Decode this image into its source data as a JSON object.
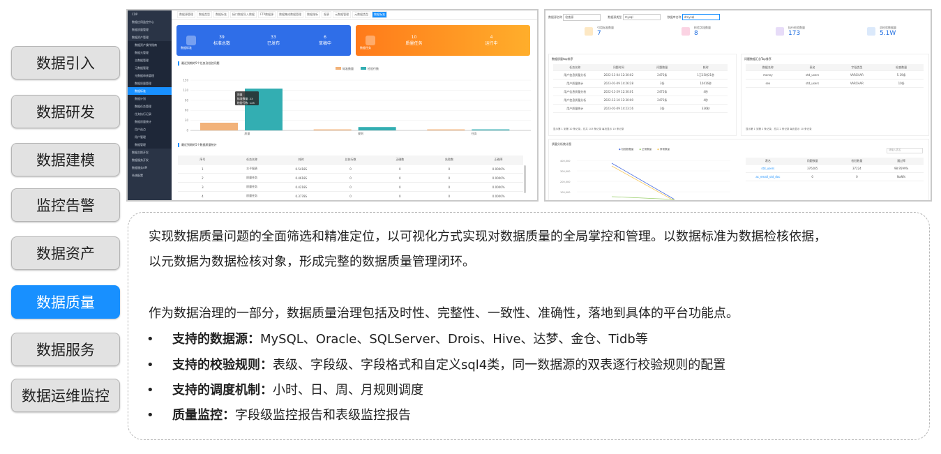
{
  "nav": {
    "items": [
      {
        "label": "数据引入",
        "active": false
      },
      {
        "label": "数据研发",
        "active": false
      },
      {
        "label": "数据建模",
        "active": false
      },
      {
        "label": "监控告警",
        "active": false
      },
      {
        "label": "数据资产",
        "active": false
      },
      {
        "label": "数据质量",
        "active": true
      },
      {
        "label": "数据服务",
        "active": false
      },
      {
        "label": "数据运维监控",
        "active": false
      }
    ]
  },
  "colors": {
    "active": "#1890ff",
    "inactive_bg": "#e2e2e2",
    "card_blue": "#2f6ee8",
    "card_orange": "#ff8a1c"
  },
  "screenshot1": {
    "sidebar": [
      "CDP",
      "数据应用监控中心",
      "数据质量管理",
      "数据资产管理",
      "数据资产操作指南",
      "数据元管理",
      "主数据管理",
      "元数据管理",
      "元数据审核管理",
      "数据质量管理",
      "数据标准",
      "数据计划",
      "数据任务管理",
      "任务执行记录",
      "数据质量统计",
      "用户选点",
      "用户管理",
      "数据管理",
      "数据交换开发",
      "数据服务开发",
      "数据服务API",
      "系统配置"
    ],
    "tabs": [
      "数据源管理",
      "数据类型",
      "数据标准",
      "接口数据导入数据",
      "FTP数据源",
      "数据集成数据管理",
      "数据指标",
      "报表",
      "元数据管理",
      "元数据类型",
      "数据标准"
    ],
    "card_blue": {
      "label": "数据标准",
      "kpis": [
        {
          "value": "39",
          "label": "标准总数"
        },
        {
          "value": "33",
          "label": "已发布"
        },
        {
          "value": "6",
          "label": "草稿中"
        }
      ]
    },
    "card_orange": {
      "label": "数据任务",
      "kpis": [
        {
          "value": "10",
          "label": "质量任务"
        },
        {
          "value": "4",
          "label": "运行中"
        }
      ]
    },
    "chart_title": "最近到期的5个任务及检验问题",
    "chart_legend": [
      "标准数量",
      "检验行数"
    ],
    "chart_tooltip": {
      "title": "质量",
      "l1": "标准数量: 23",
      "l2": "检验行数: 125"
    },
    "table_title": "最近到期的5个数据质量统计",
    "table_head": [
      "序号",
      "任务名称",
      "耗时",
      "总执行数",
      "正确数",
      "失败数",
      "正确率"
    ],
    "table_rows": [
      [
        "1",
        "主子报表",
        "0.5418S",
        "0",
        "0",
        "0",
        "0.0000%"
      ],
      [
        "2",
        "质量任务",
        "0.4618S",
        "0",
        "0",
        "0",
        "0.0000%"
      ],
      [
        "3",
        "质量任务",
        "0.4218S",
        "0",
        "0",
        "0",
        "0.0000%"
      ],
      [
        "4",
        "质量任务",
        "0.3778S",
        "0",
        "0",
        "0",
        "0.0000%"
      ]
    ]
  },
  "chart_data": {
    "type": "bar",
    "categories": [
      "质量",
      "规则",
      "任务"
    ],
    "series": [
      {
        "name": "标准数量",
        "values": [
          23,
          3,
          3
        ],
        "color": "#f2b279"
      },
      {
        "name": "检验行数",
        "values": [
          125,
          10,
          3
        ],
        "color": "#33aeb2"
      }
    ],
    "ylim": [
      0,
      150
    ],
    "yticks": [
      "0",
      "30",
      "60",
      "90",
      "120",
      "150"
    ]
  },
  "screenshot2": {
    "filters": [
      {
        "label": "数据源名称",
        "value": "检查源"
      },
      {
        "label": "数据源类型",
        "value": "mysql"
      },
      {
        "label": "数据库名称",
        "value": "dmysql"
      }
    ],
    "kpis": [
      {
        "label": "引用标准数量",
        "value": "7",
        "color": "#f5a623"
      },
      {
        "label": "检验字段数量",
        "value": "8",
        "color": "#e84b87"
      },
      {
        "label": "执行检验数量",
        "value": "173",
        "color": "#9b6bdc"
      },
      {
        "label": "总检验数据量",
        "value": "5.1W",
        "color": "#4a90e2"
      }
    ],
    "left_title": "数据质量top排序",
    "left_head": [
      "任务名称",
      "问题时间",
      "问题数量",
      "耗时"
    ],
    "left_rows": [
      [
        "用户信息质量分析",
        "2022-11-04 12:30:02",
        "2475条",
        "1万15时21秒"
      ],
      [
        "用户质量统计",
        "2023-01-09 14:26:28",
        "3条",
        "10416秒"
      ],
      [
        "用户信息质量分析",
        "2022-11-29 12:30:01",
        "2475条",
        "4秒"
      ],
      [
        "用户信息质量分析",
        "2022-12-10 12:30:00",
        "2475条",
        "4秒"
      ],
      [
        "用户质量统计",
        "2023-01-09 14:23:16",
        "3条",
        "336秒"
      ]
    ],
    "left_pager": "显示第 1 到第 10 条记录，总共 103 条记录 每页显示 10 条记录",
    "right_title": "问题数据汇总Top排序",
    "right_head": [
      "数据名称",
      "表名",
      "字段类型",
      "检查数量"
    ],
    "right_rows": [
      [
        "money",
        "std_users",
        "VARCHAR",
        "5.19条"
      ],
      [
        "sex",
        "std_users",
        "VARCHAR",
        "10条"
      ]
    ],
    "right_pager": "显示第 1 到第 2 条记录，总共 2 条记录 每页显示 10 条记录",
    "bottom_title": "质量分析统计图",
    "bottom_legend": [
      "检验数据量",
      "正常数量",
      "异常数量"
    ],
    "bottom_yticks": [
      "400,000",
      "300,000",
      "200,000",
      "100,000"
    ],
    "bottom_search": "请输入表名",
    "bottom_head": [
      "表名",
      "问题数量",
      "检验数量",
      "通过率"
    ],
    "bottom_rows": [
      [
        "std_users",
        "376285",
        "37224",
        "98.9599%"
      ],
      [
        "ac_email_std_doc",
        "0",
        "0",
        "NaN%"
      ]
    ]
  },
  "description": {
    "p1_line1": "实现数据质量问题的全面筛选和精准定位，以可视化方式实现对数据质量的全局掌控和管理。以数据标准为数据检核依据，",
    "p1_line2": "以元数据为数据检核对象，形成完整的数据质量管理闭环。",
    "p2": "作为数据治理的一部分，数据质量治理包括及时性、完整性、一致性、准确性，落地到具体的平台功能点。",
    "bullets": [
      {
        "title": "支持的数据源：",
        "text": "MySQL、Oracle、SQLServer、Drois、Hive、达梦、金仓、Tidb等"
      },
      {
        "title": "支持的校验规则：",
        "text": "表级、字段级、字段格式和自定义sql4类，同一数据源的双表逐行校验规则的配置"
      },
      {
        "title": "支持的调度机制：",
        "text": "小时、日、周、月规则调度"
      },
      {
        "title": "质量监控：",
        "text": "字段级监控报告和表级监控报告"
      }
    ],
    "bullet_char": "•"
  }
}
